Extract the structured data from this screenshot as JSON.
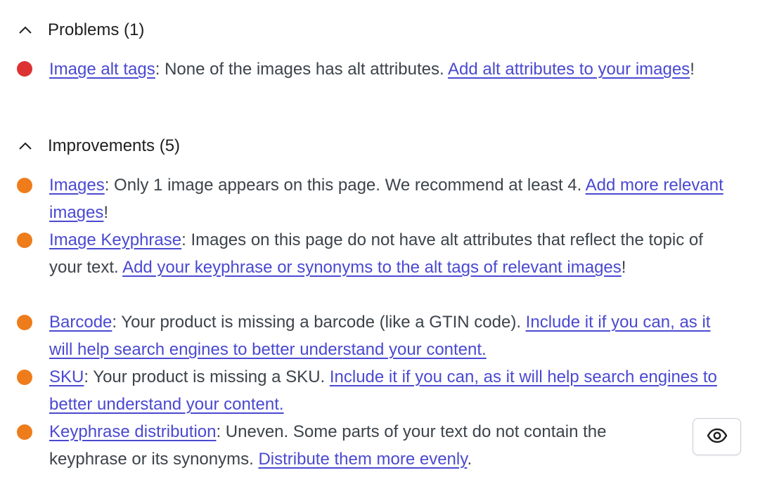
{
  "colors": {
    "problem": "#dc3232",
    "improvement": "#ee7c1b",
    "link": "#4a49d1"
  },
  "problems": {
    "title": "Problems (1)",
    "items": [
      {
        "link": "Image alt tags",
        "text": ": None of the images has alt attributes. ",
        "action": "Add alt attributes to your images",
        "end": "!"
      }
    ]
  },
  "improvements": {
    "title": "Improvements (5)",
    "items": [
      {
        "link": "Images",
        "text": ": Only 1 image appears on this page. We recommend at least 4. ",
        "action": "Add more relevant images",
        "end": "!"
      },
      {
        "link": "Image Keyphrase",
        "text": ": Images on this page do not have alt attributes that reflect the topic of your text. ",
        "action": "Add your keyphrase or synonyms to the alt tags of relevant images",
        "end": "!"
      },
      {
        "link": "Barcode",
        "text": ": Your product is missing a barcode (like a GTIN code). ",
        "action": "Include it if you can, as it will help search engines to better understand your content.",
        "end": ""
      },
      {
        "link": "SKU",
        "text": ": Your product is missing a SKU. ",
        "action": "Include it if you can, as it will help search engines to better understand your content.",
        "end": ""
      },
      {
        "link": "Keyphrase distribution",
        "text": ": Uneven. Some parts of your text do not contain the keyphrase or its synonyms. ",
        "action": "Distribute them more evenly",
        "end": "."
      }
    ]
  },
  "eye_button": {
    "icon": "eye-icon"
  }
}
